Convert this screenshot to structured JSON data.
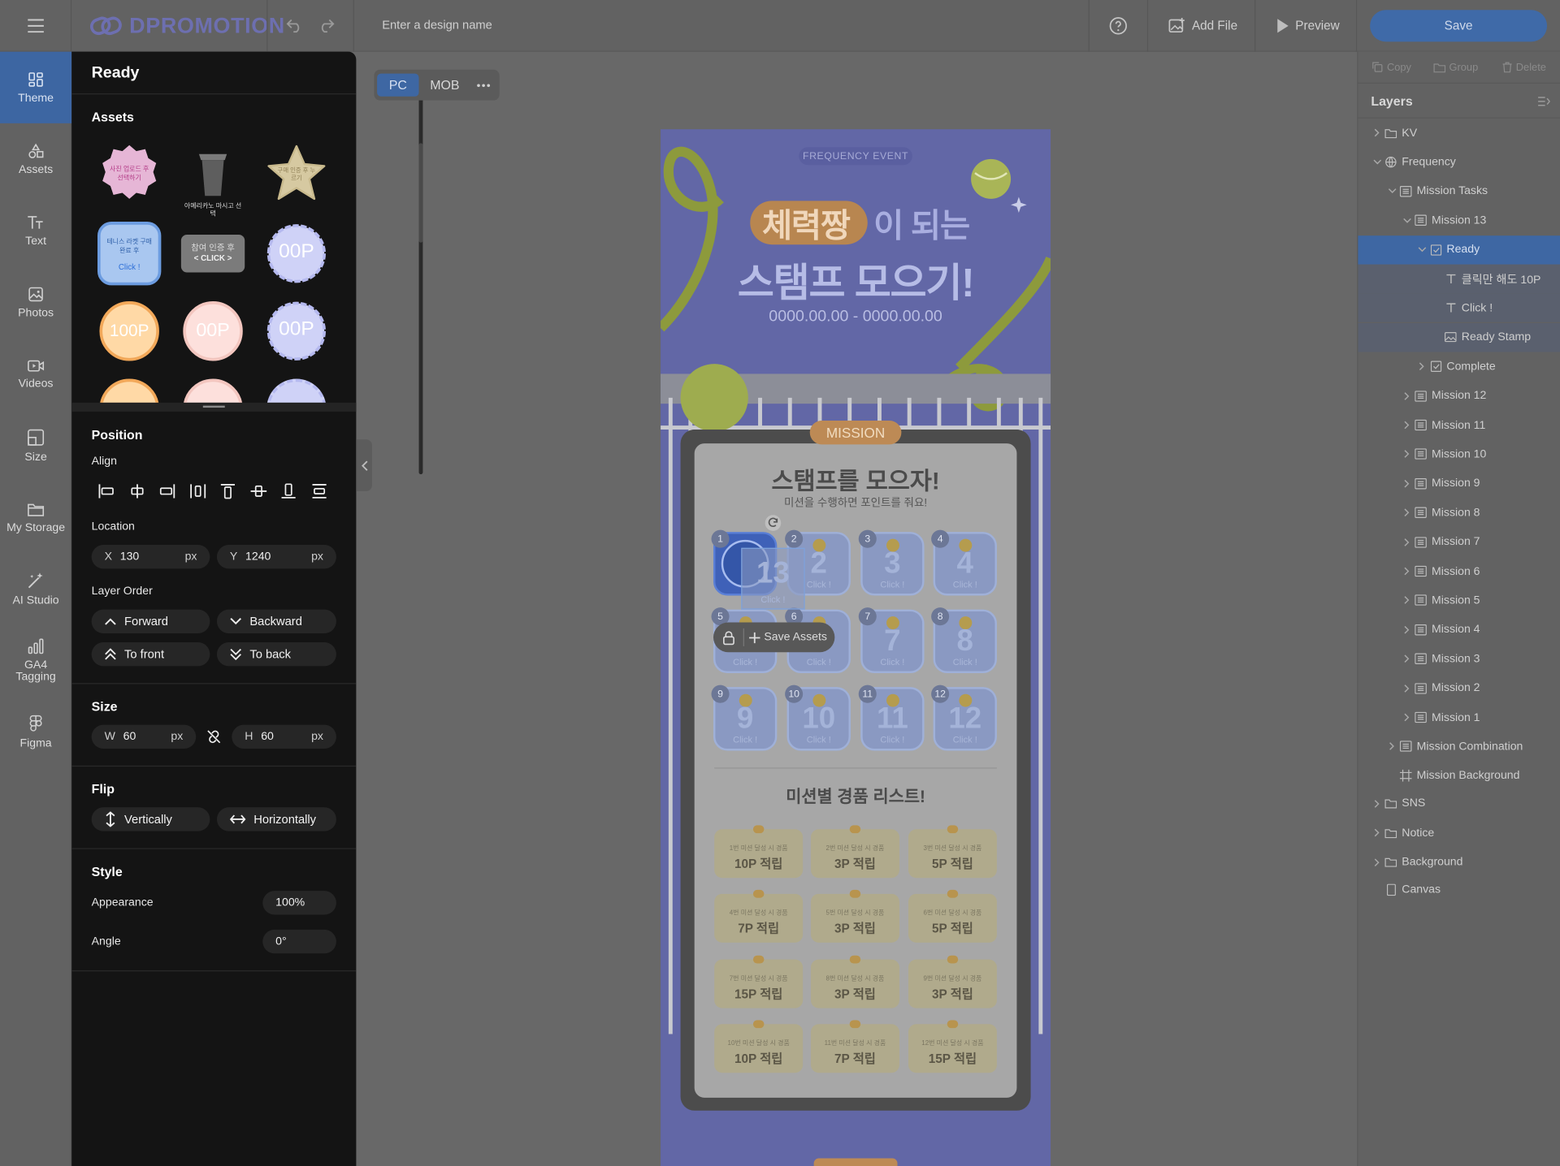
{
  "header": {
    "logo_text": "DPROMOTION",
    "design_name_placeholder": "Enter a design name",
    "add_file_label": "Add File",
    "preview_label": "Preview",
    "save_label": "Save"
  },
  "rail": {
    "items": [
      {
        "label": "Theme",
        "icon": "theme-icon"
      },
      {
        "label": "Assets",
        "icon": "assets-icon"
      },
      {
        "label": "Text",
        "icon": "text-icon"
      },
      {
        "label": "Photos",
        "icon": "photos-icon"
      },
      {
        "label": "Videos",
        "icon": "videos-icon"
      },
      {
        "label": "Size",
        "icon": "size-icon"
      },
      {
        "label": "My Storage",
        "icon": "folder-icon"
      },
      {
        "label": "AI Studio",
        "icon": "ai-wand-icon"
      },
      {
        "label": "GA4 Tagging",
        "icon": "chart-icon"
      },
      {
        "label": "Figma",
        "icon": "figma-icon"
      }
    ]
  },
  "panel": {
    "title": "Ready",
    "assets_label": "Assets",
    "assets": [
      {
        "text": "사진 업로드 후 선택하기"
      },
      {
        "text": "아메리카노 마시고 선택"
      },
      {
        "text": "구매 인증 후 누르기"
      },
      {
        "text": "테니스 라켓 구매 완료 후",
        "sub": "Click !"
      },
      {
        "text": "참여 인증 후",
        "sub": "< CLICK >"
      },
      {
        "text": "00P"
      },
      {
        "text": "100P"
      },
      {
        "text": "00P"
      },
      {
        "text": "00P"
      }
    ],
    "position_label": "Position",
    "align_label": "Align",
    "location_label": "Location",
    "x_label": "X",
    "x_value": "130",
    "x_unit": "px",
    "y_label": "Y",
    "y_value": "1240",
    "y_unit": "px",
    "layer_order_label": "Layer Order",
    "forward_label": "Forward",
    "backward_label": "Backward",
    "to_front_label": "To front",
    "to_back_label": "To back",
    "size_label": "Size",
    "w_label": "W",
    "w_value": "60",
    "w_unit": "px",
    "h_label": "H",
    "h_value": "60",
    "h_unit": "px",
    "flip_label": "Flip",
    "vertically_label": "Vertically",
    "horizontally_label": "Horizontally",
    "style_label": "Style",
    "appearance_label": "Appearance",
    "appearance_value": "100%",
    "angle_label": "Angle",
    "angle_value": "0°"
  },
  "canvas": {
    "tab_pc": "PC",
    "tab_mob": "MOB",
    "event_tag": "FREQUENCY EVENT",
    "headline_highlight": "체력짱",
    "headline_rest": "이 되는",
    "headline_line2": "스탬프 모으기!",
    "date_range": "0000.00.00 - 0000.00.00",
    "mission_badge": "MISSION",
    "stamp_title": "스탬프를 모으자!",
    "stamp_subtitle": "미션을 수행하면 포인트를 줘요!",
    "save_assets_label": "Save Assets",
    "stamps": [
      {
        "n": "1",
        "big": "",
        "ck": ""
      },
      {
        "n": "2",
        "big": "2",
        "ck": "Click !"
      },
      {
        "n": "3",
        "big": "3",
        "ck": "Click !"
      },
      {
        "n": "4",
        "big": "4",
        "ck": "Click !"
      },
      {
        "n": "5",
        "big": "",
        "ck": "Click !"
      },
      {
        "n": "6",
        "big": "",
        "ck": "Click !"
      },
      {
        "n": "7",
        "big": "7",
        "ck": "Click !"
      },
      {
        "n": "8",
        "big": "8",
        "ck": "Click !"
      },
      {
        "n": "9",
        "big": "9",
        "ck": "Click !"
      },
      {
        "n": "10",
        "big": "10",
        "ck": "Click !"
      },
      {
        "n": "11",
        "big": "11",
        "ck": "Click !"
      },
      {
        "n": "12",
        "big": "12",
        "ck": "Click !"
      }
    ],
    "selected_stamp_big": "13",
    "selected_stamp_ck": "Click !",
    "prize_title": "미션별 경품 리스트!",
    "prizes": [
      {
        "t": "1번 미션 달성 시 경품",
        "v": "10P 적립"
      },
      {
        "t": "2번 미션 달성 시 경품",
        "v": "3P 적립"
      },
      {
        "t": "3번 미션 달성 시 경품",
        "v": "5P 적립"
      },
      {
        "t": "4번 미션 달성 시 경품",
        "v": "7P 적립"
      },
      {
        "t": "5번 미션 달성 시 경품",
        "v": "3P 적립"
      },
      {
        "t": "6번 미션 달성 시 경품",
        "v": "5P 적립"
      },
      {
        "t": "7번 미션 달성 시 경품",
        "v": "15P 적립"
      },
      {
        "t": "8번 미션 달성 시 경품",
        "v": "3P 적립"
      },
      {
        "t": "9번 미션 달성 시 경품",
        "v": "3P 적립"
      },
      {
        "t": "10번 미션 달성 시 경품",
        "v": "10P 적립"
      },
      {
        "t": "11번 미션 달성 시 경품",
        "v": "7P 적립"
      },
      {
        "t": "12번 미션 달성 시 경품",
        "v": "15P 적립"
      }
    ]
  },
  "right": {
    "copy_label": "Copy",
    "group_label": "Group",
    "delete_label": "Delete",
    "layers_title": "Layers",
    "layers": [
      {
        "label": "KV",
        "icon": "folder",
        "level": 0,
        "chev": "right"
      },
      {
        "label": "Frequency",
        "icon": "globe",
        "level": 0,
        "chev": "down"
      },
      {
        "label": "Mission Tasks",
        "icon": "list",
        "level": 1,
        "chev": "down"
      },
      {
        "label": "Mission 13",
        "icon": "list",
        "level": 2,
        "chev": "down"
      },
      {
        "label": "Ready",
        "icon": "check",
        "level": 3,
        "chev": "down",
        "state": "sel"
      },
      {
        "label": "클릭만 해도 10P",
        "icon": "text",
        "level": 4,
        "chev": "",
        "state": "hl"
      },
      {
        "label": "Click !",
        "icon": "text",
        "level": 4,
        "chev": "",
        "state": "hl"
      },
      {
        "label": "Ready Stamp",
        "icon": "image",
        "level": 4,
        "chev": "",
        "state": "hl"
      },
      {
        "label": "Complete",
        "icon": "check",
        "level": 3,
        "chev": "right"
      },
      {
        "label": "Mission 12",
        "icon": "list",
        "level": 2,
        "chev": "right"
      },
      {
        "label": "Mission 11",
        "icon": "list",
        "level": 2,
        "chev": "right"
      },
      {
        "label": "Mission 10",
        "icon": "list",
        "level": 2,
        "chev": "right"
      },
      {
        "label": "Mission 9",
        "icon": "list",
        "level": 2,
        "chev": "right"
      },
      {
        "label": "Mission 8",
        "icon": "list",
        "level": 2,
        "chev": "right"
      },
      {
        "label": "Mission 7",
        "icon": "list",
        "level": 2,
        "chev": "right"
      },
      {
        "label": "Mission 6",
        "icon": "list",
        "level": 2,
        "chev": "right"
      },
      {
        "label": "Mission 5",
        "icon": "list",
        "level": 2,
        "chev": "right"
      },
      {
        "label": "Mission 4",
        "icon": "list",
        "level": 2,
        "chev": "right"
      },
      {
        "label": "Mission 3",
        "icon": "list",
        "level": 2,
        "chev": "right"
      },
      {
        "label": "Mission 2",
        "icon": "list",
        "level": 2,
        "chev": "right"
      },
      {
        "label": "Mission 1",
        "icon": "list",
        "level": 2,
        "chev": "right"
      },
      {
        "label": "Mission Combination",
        "icon": "list",
        "level": 1,
        "chev": "right"
      },
      {
        "label": "Mission Background",
        "icon": "frame",
        "level": 1,
        "chev": ""
      },
      {
        "label": "SNS",
        "icon": "folder",
        "level": 0,
        "chev": "right"
      },
      {
        "label": "Notice",
        "icon": "folder",
        "level": 0,
        "chev": "right"
      },
      {
        "label": "Background",
        "icon": "folder",
        "level": 0,
        "chev": "right"
      },
      {
        "label": "Canvas",
        "icon": "canvas",
        "level": 0,
        "chev": ""
      }
    ]
  },
  "colors": {
    "accent": "#3e67a3",
    "panel": "#141414",
    "canvas_bg": "#686868",
    "design_bg": "#6267a6"
  }
}
